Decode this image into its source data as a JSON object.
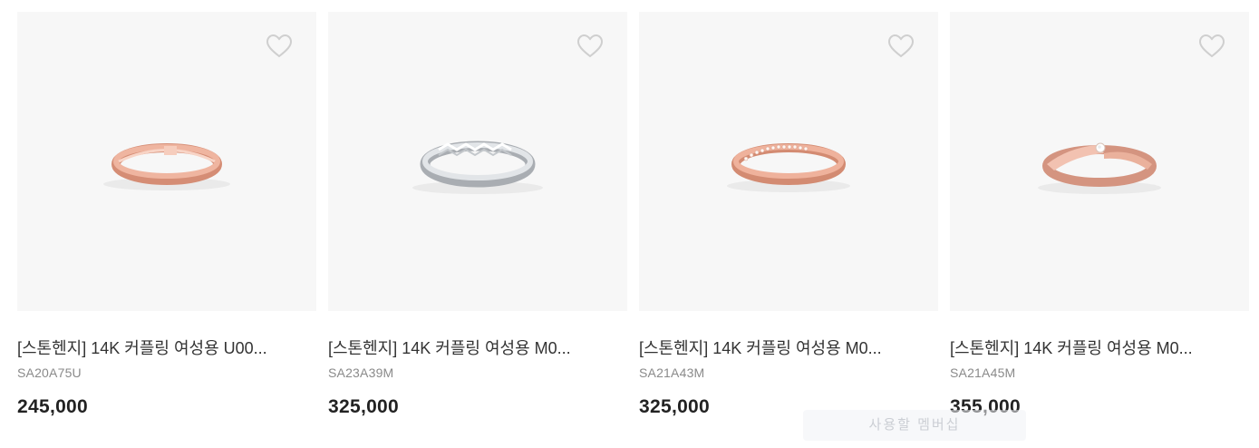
{
  "products": [
    {
      "title": "[스톤헨지] 14K 커플링 여성용 U00...",
      "code": "SA20A75U",
      "price": "245,000",
      "ring_style": "rose-band",
      "colors": {
        "metal": "#e8a58e",
        "shade": "#c97a62",
        "highlight": "#f7d2c4"
      }
    },
    {
      "title": "[스톤헨지] 14K 커플링 여성용 M0...",
      "code": "SA23A39M",
      "price": "325,000",
      "ring_style": "white-faceted",
      "colors": {
        "metal": "#dcdfe2",
        "shade": "#9ea3a8",
        "highlight": "#ffffff"
      }
    },
    {
      "title": "[스톤헨지] 14K 커플링 여성용 M0...",
      "code": "SA21A43M",
      "price": "325,000",
      "ring_style": "rose-pave",
      "colors": {
        "metal": "#e9a48c",
        "shade": "#c77b62",
        "highlight": "#f8d6c8"
      }
    },
    {
      "title": "[스톤헨지] 14K 커플링 여성용 M0...",
      "code": "SA21A45M",
      "price": "355,000",
      "ring_style": "rose-solitaire",
      "colors": {
        "metal": "#eab09a",
        "shade": "#c9846c",
        "highlight": "#fadbd0"
      }
    }
  ],
  "overlay_badge": "사용할 멤버십"
}
